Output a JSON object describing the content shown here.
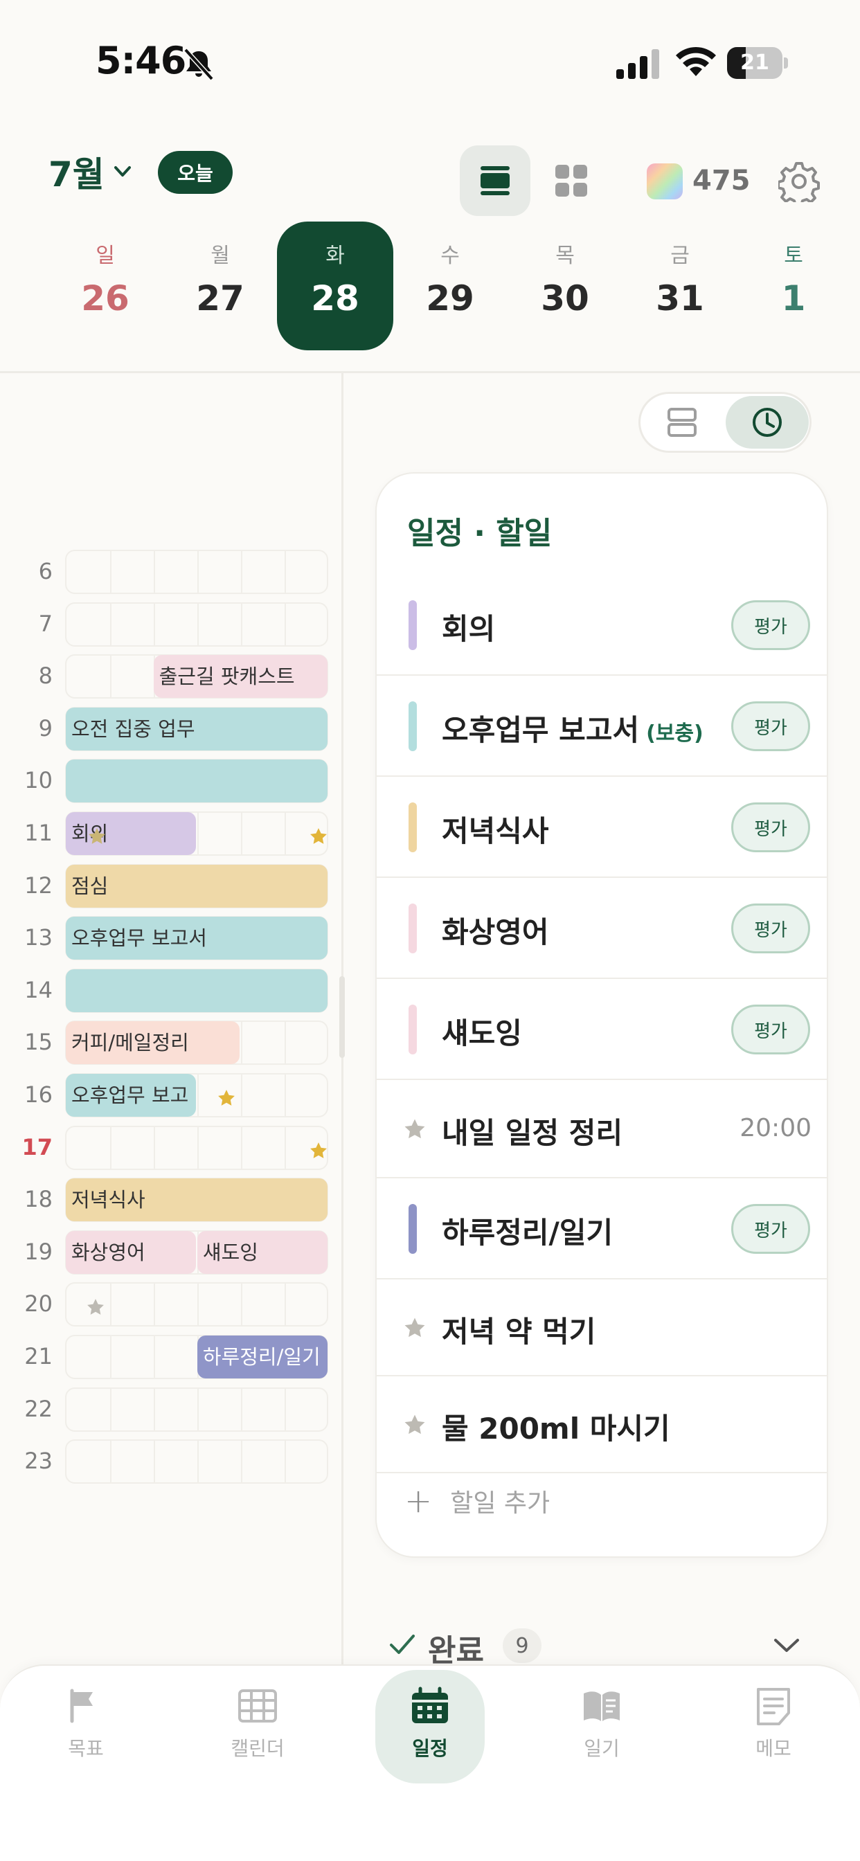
{
  "status_bar": {
    "time": "5:46",
    "battery": "21"
  },
  "header": {
    "month": "7월",
    "today_label": "오늘",
    "points": "475"
  },
  "week": [
    {
      "label": "일",
      "date": "26",
      "kind": "sun"
    },
    {
      "label": "월",
      "date": "27",
      "kind": "normal"
    },
    {
      "label": "화",
      "date": "28",
      "kind": "selected"
    },
    {
      "label": "수",
      "date": "29",
      "kind": "normal"
    },
    {
      "label": "목",
      "date": "30",
      "kind": "normal"
    },
    {
      "label": "금",
      "date": "31",
      "kind": "normal"
    },
    {
      "label": "토",
      "date": "1",
      "kind": "sat"
    }
  ],
  "timeline": {
    "hours": [
      "6",
      "7",
      "8",
      "9",
      "10",
      "11",
      "12",
      "13",
      "14",
      "15",
      "16",
      "17",
      "18",
      "19",
      "20",
      "21",
      "22",
      "23"
    ],
    "current_hour": "17",
    "events": [
      {
        "label": "출근길 팟캐스트",
        "color": "#F5DDE3"
      },
      {
        "label": "오전 집중 업무",
        "color": "#B7DEDE"
      },
      {
        "label": "",
        "color": "#B7DEDE"
      },
      {
        "label": "회의",
        "color": "#D6C8E6"
      },
      {
        "label": "점심",
        "color": "#EFD9A8"
      },
      {
        "label": "오후업무 보고서",
        "color": "#B7DEDE"
      },
      {
        "label": "",
        "color": "#B7DEDE"
      },
      {
        "label": "커피/메일정리",
        "color": "#FADFD6"
      },
      {
        "label": "오후업무 보고",
        "color": "#B7DEDE"
      },
      {
        "label": "저녁식사",
        "color": "#EFD9A8"
      },
      {
        "label": "화상영어",
        "color": "#F5DDE3"
      },
      {
        "label": "섀도잉",
        "color": "#F5DDE3"
      },
      {
        "label": "하루정리/일기",
        "color": "#8F95C8"
      }
    ]
  },
  "tasks": {
    "title": "일정 · 할일",
    "eval_label": "평가",
    "items": [
      {
        "title": "회의",
        "suffix": "",
        "kind": "bar",
        "color": "#CBBDE6",
        "time": ""
      },
      {
        "title": "오후업무 보고서",
        "suffix": "(보충)",
        "kind": "bar",
        "color": "#B3DEDE",
        "time": ""
      },
      {
        "title": "저녁식사",
        "suffix": "",
        "kind": "bar",
        "color": "#EFD5A0",
        "time": ""
      },
      {
        "title": "화상영어",
        "suffix": "",
        "kind": "bar",
        "color": "#F5D8E0",
        "time": ""
      },
      {
        "title": "섀도잉",
        "suffix": "",
        "kind": "bar",
        "color": "#F5D8E0",
        "time": ""
      },
      {
        "title": "내일 일정 정리",
        "suffix": "",
        "kind": "star",
        "color": "#BDBAB3",
        "time": "20:00"
      },
      {
        "title": "하루정리/일기",
        "suffix": "",
        "kind": "bar",
        "color": "#8E93C6",
        "time": ""
      },
      {
        "title": "저녁 약 먹기",
        "suffix": "",
        "kind": "star",
        "color": "#BDBAB3",
        "time": ""
      },
      {
        "title": "물 200ml 마시기",
        "suffix": "",
        "kind": "star",
        "color": "#BDBAB3",
        "time": ""
      }
    ],
    "add_label": "할일 추가"
  },
  "done": {
    "label": "완료",
    "count": "9"
  },
  "tabs": [
    {
      "label": "목표",
      "icon": "flag-icon",
      "active": false
    },
    {
      "label": "캘린더",
      "icon": "calendar-grid-icon",
      "active": false
    },
    {
      "label": "일정",
      "icon": "calendar-icon",
      "active": true
    },
    {
      "label": "일기",
      "icon": "book-icon",
      "active": false
    },
    {
      "label": "메모",
      "icon": "memo-icon",
      "active": false
    }
  ],
  "colors": {
    "primary": "#124A31",
    "sunday": "#C96A6F",
    "saturday": "#3C7F6E",
    "star": "#E2B53A"
  }
}
